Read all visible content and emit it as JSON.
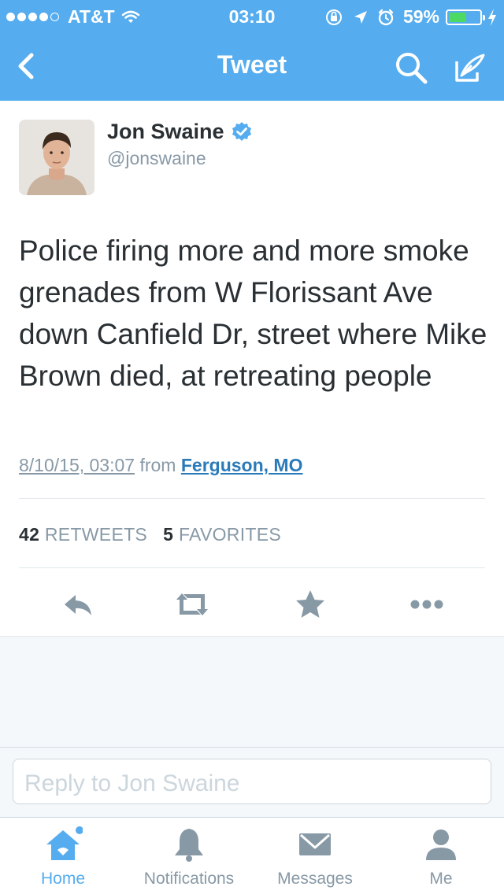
{
  "status_bar": {
    "carrier": "AT&T",
    "time": "03:10",
    "battery": "59%",
    "battery_level": 0.59
  },
  "nav": {
    "title": "Tweet"
  },
  "tweet": {
    "name": "Jon Swaine",
    "handle": "@jonswaine",
    "text": "Police firing more and more smoke grenades from W Florissant Ave down Canfield Dr, street where Mike Brown died, at retreating people",
    "timestamp": "8/10/15, 03:07",
    "from_label": "from",
    "location": "Ferguson, MO",
    "retweets_count": "42",
    "retweets_label": "RETWEETS",
    "favorites_count": "5",
    "favorites_label": "FAVORITES"
  },
  "reply": {
    "placeholder": "Reply to Jon Swaine"
  },
  "tabs": [
    {
      "label": "Home",
      "icon": "home-icon",
      "active": true
    },
    {
      "label": "Notifications",
      "icon": "bell-icon"
    },
    {
      "label": "Messages",
      "icon": "envelope-icon"
    },
    {
      "label": "Me",
      "icon": "person-icon"
    }
  ],
  "colors": {
    "brand": "#55acee",
    "link": "#2b7bb9",
    "text": "#292f33",
    "muted": "#8899a6"
  }
}
